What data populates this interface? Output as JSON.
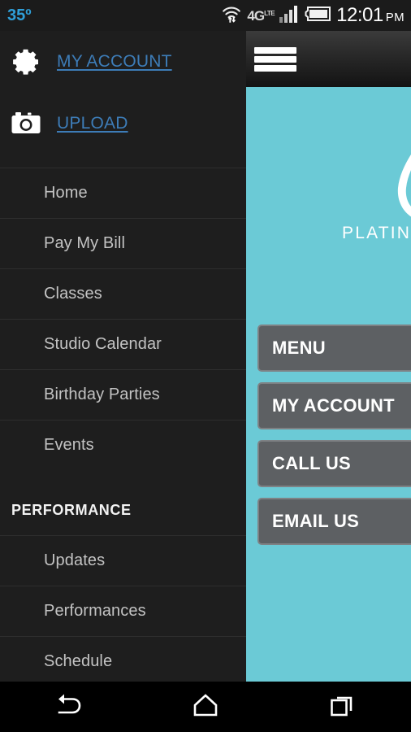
{
  "status_bar": {
    "temperature": "35º",
    "network_label": "4G",
    "network_sup": "LTE",
    "time": "12:01",
    "ampm": "PM",
    "icons": {
      "wifi": "wifi-icon",
      "signal": "cell-signal-icon",
      "battery": "battery-icon"
    }
  },
  "drawer": {
    "account_links": [
      {
        "label": "MY ACCOUNT",
        "icon": "gear-icon",
        "name": "my-account"
      },
      {
        "label": "UPLOAD",
        "icon": "camera-icon",
        "name": "upload"
      }
    ],
    "items": [
      {
        "type": "item",
        "label": "Home",
        "name": "home"
      },
      {
        "type": "item",
        "label": "Pay My Bill",
        "name": "pay-my-bill"
      },
      {
        "type": "item",
        "label": "Classes",
        "name": "classes"
      },
      {
        "type": "item",
        "label": "Studio Calendar",
        "name": "studio-calendar"
      },
      {
        "type": "item",
        "label": "Birthday Parties",
        "name": "birthday-parties"
      },
      {
        "type": "item",
        "label": "Events",
        "name": "events"
      },
      {
        "type": "section",
        "label": "PERFORMANCE",
        "name": "performance"
      },
      {
        "type": "item",
        "label": "Updates",
        "name": "updates"
      },
      {
        "type": "item",
        "label": "Performances",
        "name": "performances"
      },
      {
        "type": "item",
        "label": "Schedule",
        "name": "schedule"
      }
    ]
  },
  "content": {
    "header": {
      "menu_icon": "hamburger-icon"
    },
    "brand": {
      "logo": "platinum-logo-mark",
      "name": "PLATINUM"
    },
    "buttons": [
      {
        "label": "MENU",
        "name": "menu"
      },
      {
        "label": "MY ACCOUNT",
        "name": "my-account"
      },
      {
        "label": "CALL US",
        "name": "call-us"
      },
      {
        "label": "EMAIL US",
        "name": "email-us"
      }
    ]
  },
  "nav_bar": {
    "keys": [
      {
        "name": "back",
        "icon": "back-arrow-icon"
      },
      {
        "name": "home",
        "icon": "home-icon"
      },
      {
        "name": "recents",
        "icon": "recents-icon"
      }
    ]
  },
  "colors": {
    "teal": "#6bcad6",
    "link_blue": "#3d7cb7",
    "temp_blue": "#2f9fd8",
    "drawer_bg": "#1e1e1e",
    "button_gray": "#5d6063"
  }
}
